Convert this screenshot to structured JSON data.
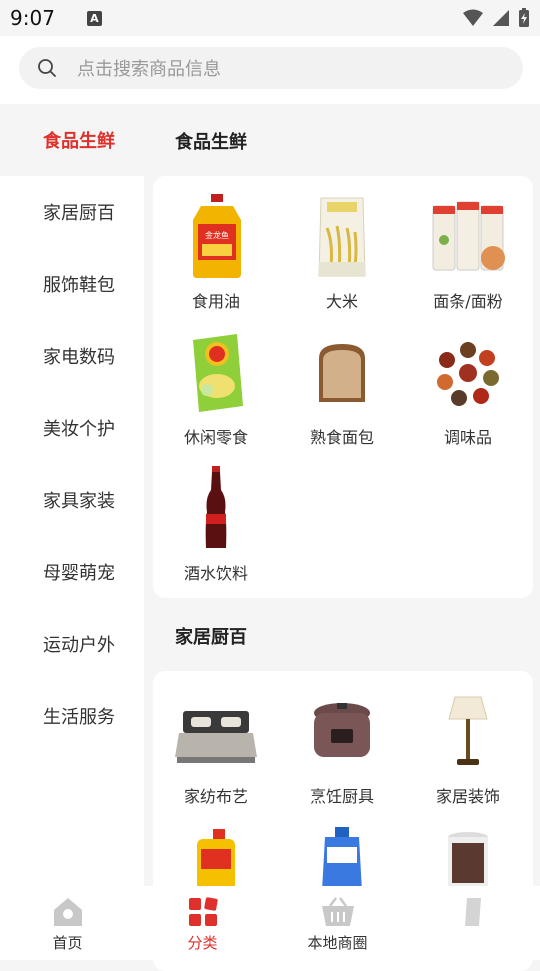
{
  "status_bar": {
    "time": "9:07",
    "notification_letter": "A"
  },
  "search": {
    "placeholder": "点击搜索商品信息"
  },
  "sidebar": {
    "items": [
      {
        "label": "食品生鲜",
        "active": true
      },
      {
        "label": "家居厨百"
      },
      {
        "label": "服饰鞋包"
      },
      {
        "label": "家电数码"
      },
      {
        "label": "美妆个护"
      },
      {
        "label": "家具家装"
      },
      {
        "label": "母婴萌宠"
      },
      {
        "label": "运动户外"
      },
      {
        "label": "生活服务"
      }
    ]
  },
  "sections": [
    {
      "title": "食品生鲜",
      "items": [
        {
          "label": "食用油",
          "icon": "cooking-oil-bottle"
        },
        {
          "label": "大米",
          "icon": "rice-bag"
        },
        {
          "label": "面条/面粉",
          "icon": "noodle-packages"
        },
        {
          "label": "休闲零食",
          "icon": "chips-bag"
        },
        {
          "label": "熟食面包",
          "icon": "bread-slice"
        },
        {
          "label": "调味品",
          "icon": "spice-bowls"
        },
        {
          "label": "酒水饮料",
          "icon": "cola-bottle"
        }
      ]
    },
    {
      "title": "家居厨百",
      "items": [
        {
          "label": "家纺布艺",
          "icon": "bed"
        },
        {
          "label": "烹饪厨具",
          "icon": "rice-cooker"
        },
        {
          "label": "家居装饰",
          "icon": "table-lamp"
        },
        {
          "label": "",
          "icon": "detergent-bottle"
        },
        {
          "label": "",
          "icon": "laundry-detergent"
        },
        {
          "label": "",
          "icon": "storage-jar"
        }
      ]
    }
  ],
  "bottom_nav": [
    {
      "label": "首页",
      "icon": "home-icon"
    },
    {
      "label": "分类",
      "icon": "category-icon",
      "active": true
    },
    {
      "label": "本地商圈",
      "icon": "basket-icon"
    },
    {
      "label": "",
      "icon": "profile-icon"
    }
  ],
  "colors": {
    "accent": "#e0302c",
    "background": "#f5f5f5"
  }
}
